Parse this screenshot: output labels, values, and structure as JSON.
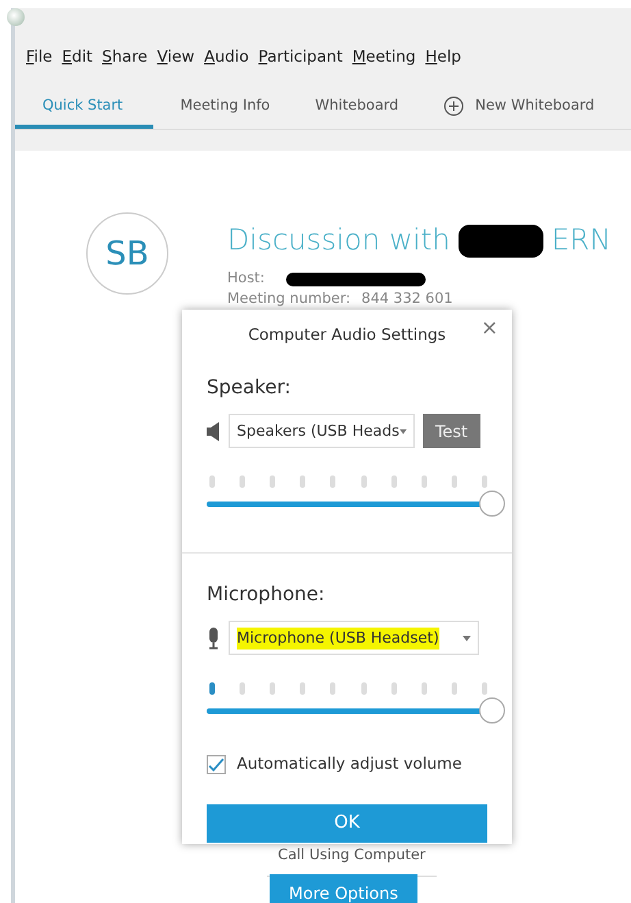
{
  "menu": [
    "File",
    "Edit",
    "Share",
    "View",
    "Audio",
    "Participant",
    "Meeting",
    "Help"
  ],
  "tabs": [
    {
      "label": "Quick Start",
      "selected": true,
      "kind": "tab"
    },
    {
      "label": "Meeting Info",
      "selected": false,
      "kind": "tab"
    },
    {
      "label": "Whiteboard",
      "selected": false,
      "kind": "tab"
    },
    {
      "label": "New Whiteboard",
      "selected": false,
      "kind": "add"
    }
  ],
  "meeting": {
    "initials": "SB",
    "title_start": "Discussion with",
    "title_end": "ERN",
    "host_label": "Host:",
    "number_label": "Meeting number:",
    "number": "844 332 601"
  },
  "dialog": {
    "title": "Computer Audio Settings",
    "close": "×",
    "speaker": {
      "label": "Speaker:",
      "device": "Speakers (USB Heads",
      "test": "Test",
      "volume": {
        "level": 1
      },
      "highlighted": false
    },
    "microphone": {
      "label": "Microphone:",
      "device": "Microphone (USB Headset)",
      "meter": {
        "level": 0.1
      },
      "volume": {
        "level": 1
      },
      "highlighted": true
    },
    "auto_adjust": {
      "label": "Automatically adjust volume",
      "checked": true
    },
    "ok": "OK"
  },
  "call_option": "Call Using Computer",
  "more_options": "More Options"
}
